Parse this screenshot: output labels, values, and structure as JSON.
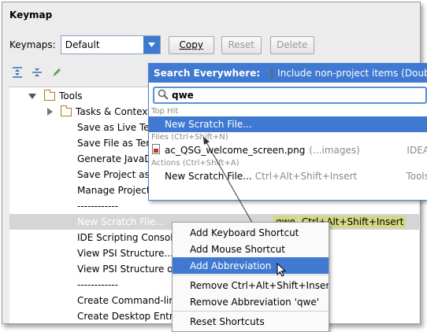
{
  "dialog": {
    "title": "Keymap"
  },
  "keymaps": {
    "label": "Keymaps:",
    "selected": "Default",
    "copy_label": "Copy",
    "reset_label": "Reset",
    "delete_label": "Delete"
  },
  "toolbar": {
    "icons": [
      "expand-all-icon",
      "collapse-all-icon",
      "edit-pencil-icon"
    ]
  },
  "tree": {
    "tools": "Tools",
    "tasks": "Tasks & Contexts",
    "items": [
      "Save as Live Temp",
      "Save File as Temp",
      "Generate JavaDoc",
      "Save Project as Te",
      "Manage Project T",
      "------------",
      "New Scratch File...",
      "IDE Scripting Console",
      "View PSI Structure...",
      "View PSI Structure of C",
      "------------",
      "Create Command-line",
      "Create Desktop Entry..."
    ],
    "selected_abbrev": "qwe",
    "selected_shortcut": "Ctrl+Alt+Shift+Insert"
  },
  "search": {
    "title": "Search Everywhere:",
    "include_label": "Include non-project items (Double",
    "query": "qwe",
    "top_hit_label": "Top Hit",
    "top_hit_item": "New Scratch File...",
    "files_label": "Files (Ctrl+Shift+N)",
    "file_name": "ac_QSG_welcome_screen.png",
    "file_path": "(...images)",
    "file_right": "IDEA",
    "actions_label": "Actions (Ctrl+Shift+A)",
    "action_name": "New Scratch File...",
    "action_shortcut": "Ctrl+Alt+Shift+Insert",
    "action_right": "Tools"
  },
  "context_menu": {
    "add_keyboard": "Add Keyboard Shortcut",
    "add_mouse": "Add Mouse Shortcut",
    "add_abbrev": "Add Abbreviation",
    "remove_shortcut": "Remove Ctrl+Alt+Shift+Insert",
    "remove_abbrev": "Remove Abbreviation 'qwe'",
    "reset": "Reset Shortcuts"
  },
  "colors": {
    "accent": "#3f79d1",
    "panel_bg": "#ececec",
    "abbrev_highlight": "#d4d886"
  }
}
